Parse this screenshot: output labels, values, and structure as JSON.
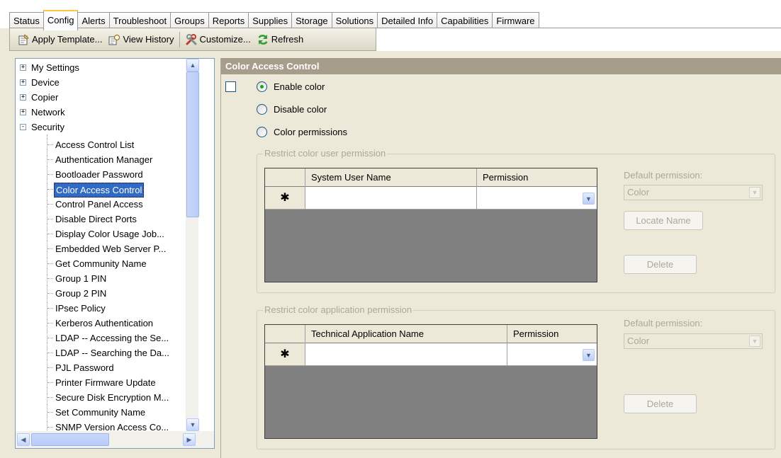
{
  "tabs": [
    {
      "label": "Status"
    },
    {
      "label": "Config",
      "active": true
    },
    {
      "label": "Alerts"
    },
    {
      "label": "Troubleshoot"
    },
    {
      "label": "Groups"
    },
    {
      "label": "Reports"
    },
    {
      "label": "Supplies"
    },
    {
      "label": "Storage"
    },
    {
      "label": "Solutions"
    },
    {
      "label": "Detailed Info"
    },
    {
      "label": "Capabilities"
    },
    {
      "label": "Firmware"
    }
  ],
  "toolbar": {
    "apply_template": "Apply Template...",
    "view_history": "View History",
    "customize": "Customize...",
    "refresh": "Refresh"
  },
  "tree": {
    "top_nodes": [
      {
        "label": "My Settings",
        "expander": "+"
      },
      {
        "label": "Device",
        "expander": "+"
      },
      {
        "label": "Copier",
        "expander": "+"
      },
      {
        "label": "Network",
        "expander": "+"
      },
      {
        "label": "Security",
        "expander": "-"
      }
    ],
    "security_children": [
      "Access Control List",
      "Authentication Manager",
      "Bootloader Password",
      "Color Access Control",
      "Control Panel Access",
      "Disable Direct Ports",
      "Display Color Usage Job...",
      "Embedded Web Server P...",
      "Get Community Name",
      "Group 1 PIN",
      "Group 2 PIN",
      "IPsec Policy",
      "Kerberos Authentication",
      "LDAP -- Accessing the Se...",
      "LDAP -- Searching the Da...",
      "PJL Password",
      "Printer Firmware Update",
      "Secure Disk Encryption M...",
      "Set Community Name",
      "SNMP Version Access Co..."
    ],
    "selected": "Color Access Control"
  },
  "panel": {
    "title": "Color Access Control",
    "radios": [
      {
        "label": "Enable color",
        "checked": true
      },
      {
        "label": "Disable color",
        "checked": false
      },
      {
        "label": "Color permissions",
        "checked": false
      }
    ],
    "user_group": {
      "title": "Restrict color user permission",
      "col1": "System User Name",
      "col2": "Permission",
      "new_row_marker": "✱",
      "default_label": "Default permission:",
      "default_value": "Color",
      "locate_button": "Locate Name",
      "delete_button": "Delete"
    },
    "app_group": {
      "title": "Restrict color application permission",
      "col1": "Technical Application Name",
      "col2": "Permission",
      "new_row_marker": "✱",
      "default_label": "Default permission:",
      "default_value": "Color",
      "delete_button": "Delete"
    }
  },
  "icons": {
    "expand_plus": "+",
    "collapse_minus": "−",
    "scroll_up": "▲",
    "scroll_down": "▼",
    "scroll_left": "◀",
    "scroll_right": "▶",
    "dropdown": "▼"
  },
  "colors": {
    "header_bg": "#a79d8b",
    "selection_bg": "#316ac5",
    "radio_dot": "#21a121",
    "active_tab_highlight": "#ffc83c"
  }
}
